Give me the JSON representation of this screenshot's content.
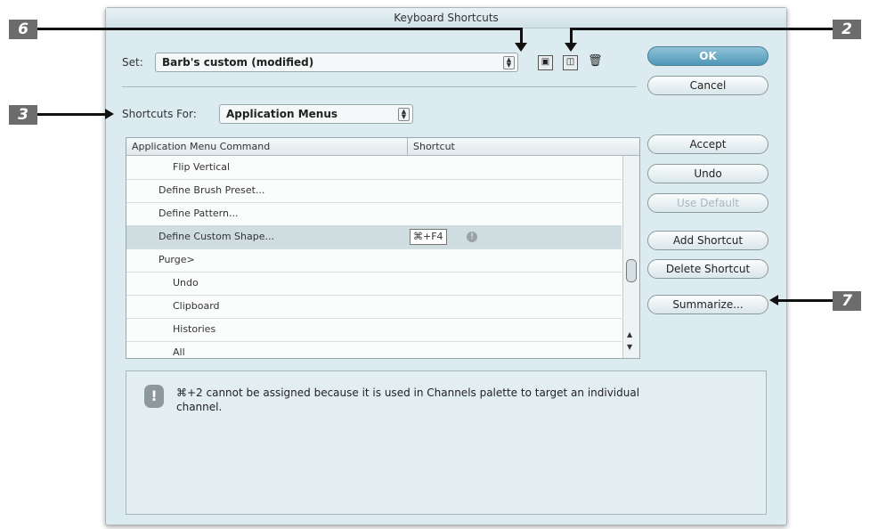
{
  "window": {
    "title": "Keyboard Shortcuts"
  },
  "set": {
    "label": "Set:",
    "value": "Barb's custom (modified)"
  },
  "shortcuts_for": {
    "label": "Shortcuts For:",
    "value": "Application Menus"
  },
  "buttons": {
    "ok": "OK",
    "cancel": "Cancel",
    "accept": "Accept",
    "undo": "Undo",
    "use_default": "Use Default",
    "add_shortcut": "Add Shortcut",
    "delete_shortcut": "Delete Shortcut",
    "summarize": "Summarize..."
  },
  "table": {
    "columns": [
      "Application Menu Command",
      "Shortcut"
    ],
    "rows": [
      {
        "command": "Flip Vertical",
        "shortcut": ""
      },
      {
        "command": "Define Brush Preset...",
        "shortcut": ""
      },
      {
        "command": "Define Pattern...",
        "shortcut": ""
      },
      {
        "command": "Define Custom Shape...",
        "shortcut": "⌘+F4"
      },
      {
        "command": "Purge>",
        "shortcut": ""
      },
      {
        "command": "Undo",
        "shortcut": ""
      },
      {
        "command": "Clipboard",
        "shortcut": ""
      },
      {
        "command": "Histories",
        "shortcut": ""
      },
      {
        "command": "All",
        "shortcut": ""
      }
    ]
  },
  "message": {
    "line1": "⌘+2 cannot be assigned because it is used in Channels palette to target an individual",
    "line2": "channel."
  },
  "callouts": {
    "c6": "6",
    "c2": "2",
    "c3": "3",
    "c7": "7"
  },
  "icons": {
    "save": "save-set-icon",
    "new": "new-set-icon",
    "delete": "delete-set-icon",
    "warning": "warning-icon"
  }
}
